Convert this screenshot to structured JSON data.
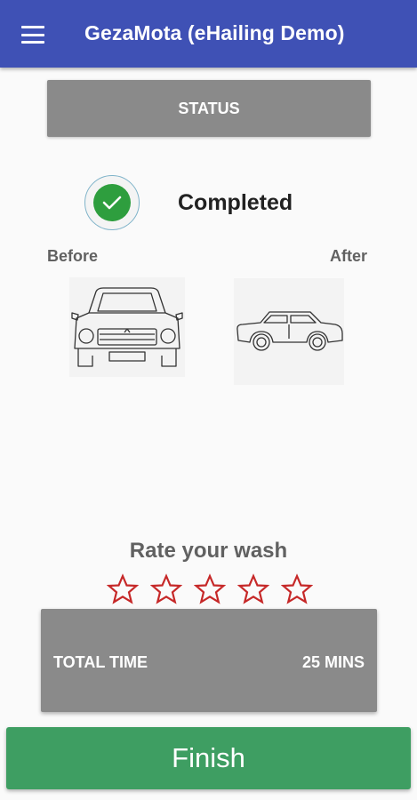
{
  "appbar": {
    "title": "GezaMota (eHailing Demo)",
    "menu_icon": "hamburger-menu-icon",
    "color": "#3f51b5"
  },
  "status_header": {
    "label": "STATUS"
  },
  "status": {
    "icon": "check-circle-icon",
    "text": "Completed",
    "color": "#2e9e3e"
  },
  "photos": {
    "before_label": "Before",
    "after_label": "After"
  },
  "rating": {
    "title": "Rate your wash",
    "max_stars": 5,
    "value": 0,
    "star_color": "#c62828"
  },
  "total": {
    "label": "TOTAL TIME",
    "value": "25 MINS"
  },
  "finish": {
    "label": "Finish",
    "color": "#3e9e62"
  }
}
